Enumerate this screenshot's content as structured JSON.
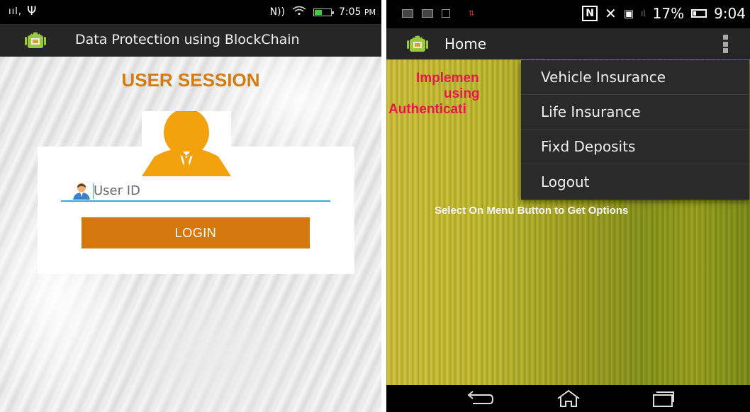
{
  "left_screen": {
    "status_bar": {
      "time": "7:05",
      "ampm": "PM",
      "network": "N))"
    },
    "app_bar": {
      "title": "Data Protection using BlockChain",
      "logo_icon": "android-robot-icon"
    },
    "session_title": "USER SESSION",
    "login_form": {
      "user_id_placeholder": "User ID",
      "user_id_value": "",
      "login_label": "LOGIN"
    },
    "colors": {
      "accent": "#d4770d",
      "title": "#d47c12",
      "avatar": "#f2a20c",
      "underline": "#3aa8d8"
    }
  },
  "right_screen": {
    "status_bar": {
      "battery_percent": "17%",
      "time": "9:04"
    },
    "app_bar": {
      "title": "Home",
      "logo_icon": "android-robot-icon"
    },
    "content": {
      "heading_lines": [
        "Implemen",
        "using",
        "Authenticati"
      ],
      "hint": "Select On Menu Button to Get Options"
    },
    "menu": {
      "items": [
        "Vehicle Insurance",
        "Life Insurance",
        "Fixd Deposits",
        "Logout"
      ]
    },
    "colors": {
      "heading": "#e8174f",
      "menu_bg": "#2a2a2a"
    }
  }
}
